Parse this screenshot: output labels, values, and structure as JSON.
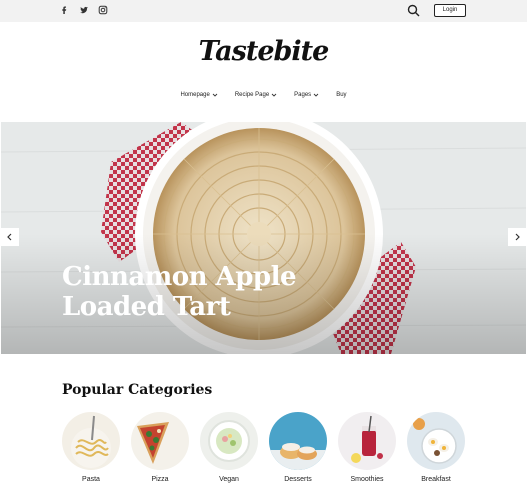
{
  "topbar": {
    "social": [
      {
        "name": "facebook-icon"
      },
      {
        "name": "twitter-icon"
      },
      {
        "name": "instagram-icon"
      }
    ],
    "search_icon": "search-icon",
    "login_label": "Login"
  },
  "brand": {
    "logo_text": "Tastebite"
  },
  "nav": {
    "items": [
      {
        "label": "Homepage",
        "has_dropdown": true
      },
      {
        "label": "Recipe Page",
        "has_dropdown": true
      },
      {
        "label": "Pages",
        "has_dropdown": true
      },
      {
        "label": "Buy",
        "has_dropdown": false
      }
    ]
  },
  "hero": {
    "kicker": "",
    "title_line1": "Cinnamon Apple",
    "title_line2": "Loaded Tart",
    "prev_icon": "chevron-left-icon",
    "next_icon": "chevron-right-icon"
  },
  "categories": {
    "title": "Popular Categories",
    "items": [
      {
        "label": "Pasta"
      },
      {
        "label": "Pizza"
      },
      {
        "label": "Vegan"
      },
      {
        "label": "Desserts"
      },
      {
        "label": "Smoothies"
      },
      {
        "label": "Breakfast"
      }
    ]
  },
  "colors": {
    "topbar_bg": "#f2f2f2",
    "text": "#1a1a1a",
    "accent_red": "#c2344a"
  }
}
